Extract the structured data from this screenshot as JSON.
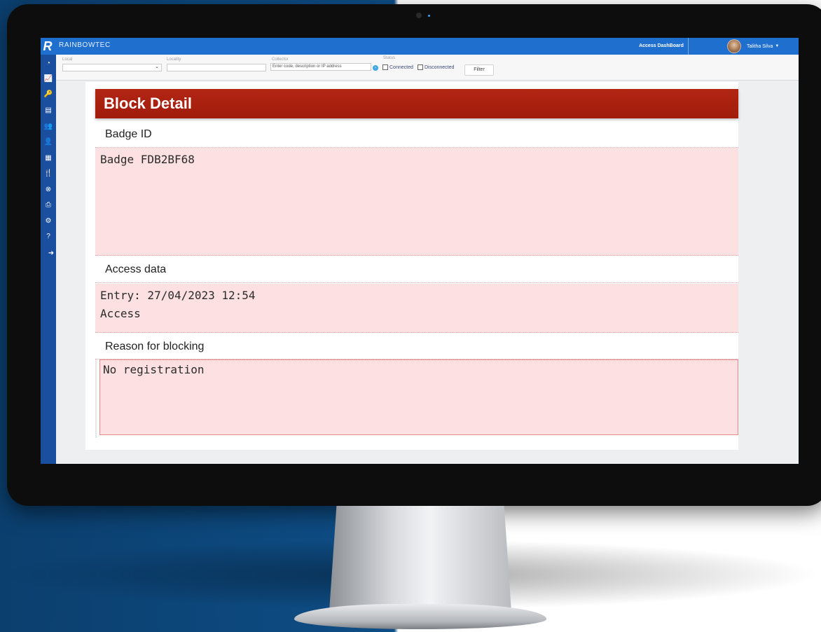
{
  "app": {
    "brand": "RAINBOWTEC",
    "logo_letter": "R",
    "dashboard_button": "Access DashBoard",
    "user_name": "Talitha Silva"
  },
  "sidebar": {
    "items": [
      {
        "icon": "gauge-icon",
        "glyph": "◔"
      },
      {
        "icon": "chart-icon",
        "glyph": "📈"
      },
      {
        "icon": "key-icon",
        "glyph": "🔑"
      },
      {
        "icon": "document-icon",
        "glyph": "▤"
      },
      {
        "icon": "users-icon",
        "glyph": "👥"
      },
      {
        "icon": "user-icon",
        "glyph": "👤"
      },
      {
        "icon": "calendar-icon",
        "glyph": "▦"
      },
      {
        "icon": "cutlery-icon",
        "glyph": "🍴"
      },
      {
        "icon": "close-circle-icon",
        "glyph": "⊗"
      },
      {
        "icon": "printer-icon",
        "glyph": "⎙"
      },
      {
        "icon": "gear-icon",
        "glyph": "⚙"
      },
      {
        "icon": "help-icon",
        "glyph": "?"
      },
      {
        "icon": "arrow-right-circle-icon",
        "glyph": "➜"
      }
    ]
  },
  "filters": {
    "local_label": "Local",
    "local_value": "",
    "locality_label": "Locality",
    "locality_value": "",
    "collector_label": "Collector",
    "collector_placeholder": "Enter code, description or IP address",
    "status_label": "Status",
    "connected_label": "Connected",
    "disconnected_label": "Disconnected",
    "filter_button": "Filter"
  },
  "detail": {
    "title": "Block Detail",
    "badge_section": "Badge ID",
    "badge_value": "Badge FDB2BF68",
    "access_section": "Access data",
    "entry_value": "Entry: 27/04/2023 12:54",
    "access_value": "Access",
    "reason_section": "Reason for blocking",
    "reason_value": "No registration"
  },
  "colors": {
    "topbar": "#1f6fcf",
    "sidebar": "#1a4fa0",
    "header_red": "#a11c0b",
    "section_pink": "#fde1e2"
  }
}
